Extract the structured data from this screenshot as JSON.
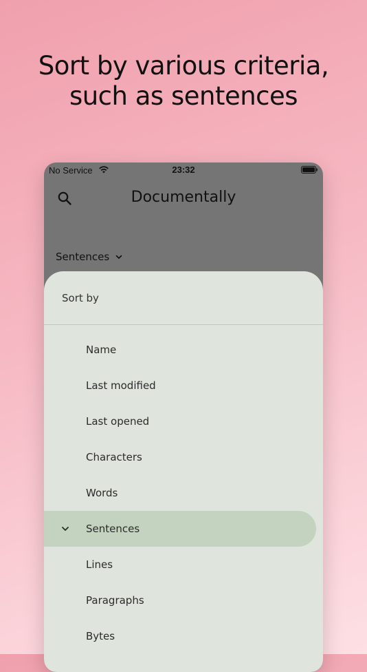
{
  "headline": {
    "line1": "Sort by various criteria,",
    "line2": "such as sentences"
  },
  "status_bar": {
    "carrier": "No Service",
    "time": "23:32"
  },
  "app_bar": {
    "title": "Documentally"
  },
  "sort_dropdown": {
    "label": "Sentences"
  },
  "sheet": {
    "title": "Sort by",
    "options": [
      {
        "label": "Name"
      },
      {
        "label": "Last modified"
      },
      {
        "label": "Last opened"
      },
      {
        "label": "Characters"
      },
      {
        "label": "Words"
      },
      {
        "label": "Sentences"
      },
      {
        "label": "Lines"
      },
      {
        "label": "Paragraphs"
      },
      {
        "label": "Bytes"
      }
    ]
  },
  "icons": {
    "search": "search-icon",
    "wifi": "wifi-icon",
    "battery": "battery-icon",
    "dropdown": "chevron-down-icon",
    "selected": "chevron-down-icon"
  },
  "colors": {
    "appbar_bg": "#757575",
    "sheet_bg": "#dfe5dc",
    "selected_bg": "#c3d3c0",
    "background_top": "#f0a0ad",
    "background_bottom": "#fde0e4"
  }
}
